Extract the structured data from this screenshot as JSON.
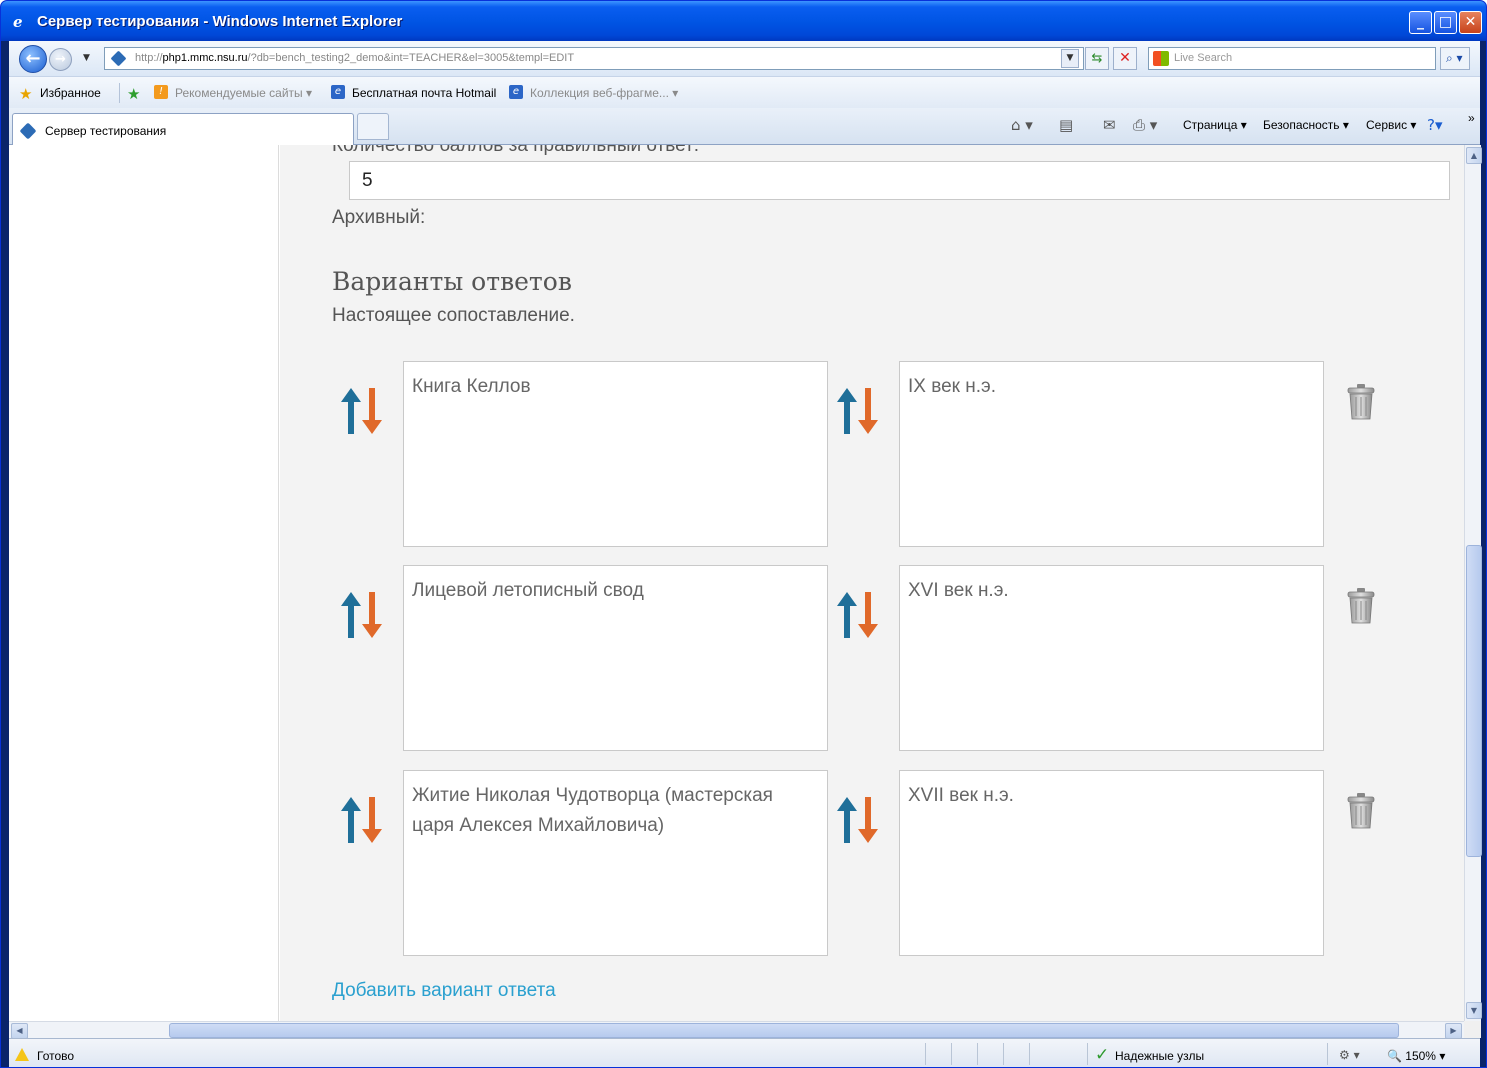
{
  "window": {
    "title": "Сервер тестирования - Windows Internet Explorer",
    "minimize": "_",
    "maximize": "□",
    "close": "✕"
  },
  "address": {
    "url_prefix": "http://",
    "url_host": "php1.mmc.nsu.ru",
    "url_rest": "/?db=bench_testing2_demo&int=TEACHER&el=3005&templ=EDIT",
    "search_placeholder": "Live Search"
  },
  "favorites": {
    "favorites_label": "Избранное",
    "items": [
      {
        "label": "Рекомендуемые сайты ▾"
      },
      {
        "label": "Бесплатная почта Hotmail"
      },
      {
        "label": "Коллекция веб-фрагме...  ▾"
      }
    ]
  },
  "tabs": {
    "active_label": "Сервер тестирования"
  },
  "commands": {
    "page": "Страница ▾",
    "security": "Безопасность ▾",
    "tools": "Сервис ▾",
    "more": "»"
  },
  "form": {
    "points_label": "Количество баллов за правильный ответ:",
    "points_value": "5",
    "archive_label": "Архивный:",
    "section_title": "Варианты ответов",
    "section_subtitle": "Настоящее сопоставление.",
    "pairs": [
      {
        "left": "Книга Келлов",
        "right": "IX век н.э."
      },
      {
        "left": "Лицевой летописный свод",
        "right": "XVI век н.э."
      },
      {
        "left": "Житие Николая Чудотворца (мастерская царя Алексея Михайловича)",
        "right": "XVII век н.э."
      }
    ],
    "add_link": "Добавить вариант ответа"
  },
  "status": {
    "ready": "Готово",
    "trusted": "Надежные узлы",
    "zoom": "150%"
  },
  "colors": {
    "arrow_up": "#1f6f99",
    "arrow_down": "#e0692a",
    "link": "#2aa0cf",
    "titlebar": "#0054e3"
  },
  "icons": {
    "swap": "swap-arrows-icon",
    "delete": "trash-icon",
    "back": "back-arrow-icon",
    "forward": "forward-arrow-icon"
  }
}
